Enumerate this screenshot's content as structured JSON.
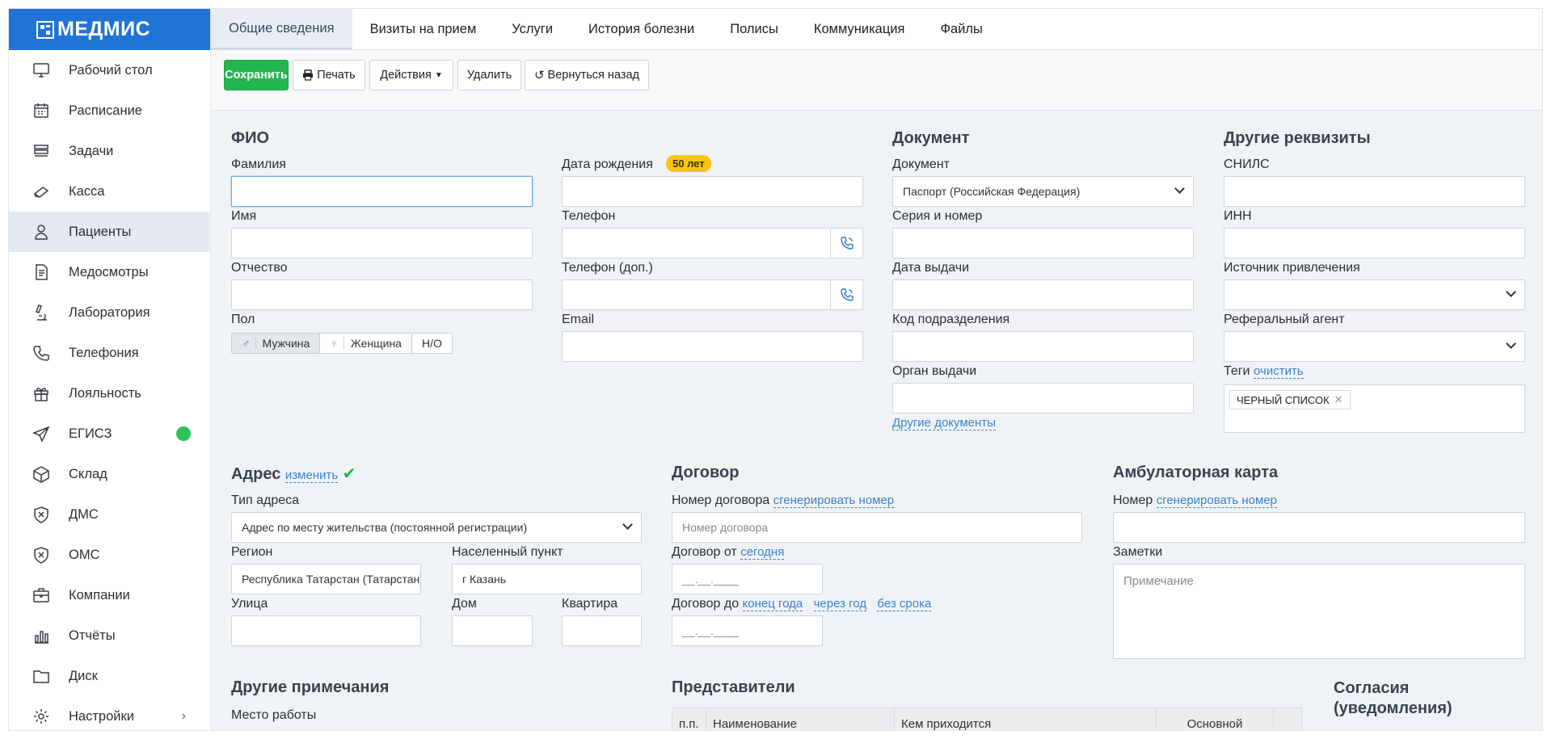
{
  "app": {
    "brand": "МЕДМИС"
  },
  "sidebar": {
    "items": [
      {
        "label": "Рабочий стол",
        "icon": "monitor-icon"
      },
      {
        "label": "Расписание",
        "icon": "calendar-icon"
      },
      {
        "label": "Задачи",
        "icon": "tasks-icon"
      },
      {
        "label": "Касса",
        "icon": "cash-icon"
      },
      {
        "label": "Пациенты",
        "icon": "patient-icon",
        "active": true
      },
      {
        "label": "Медосмотры",
        "icon": "document-icon"
      },
      {
        "label": "Лаборатория",
        "icon": "microscope-icon"
      },
      {
        "label": "Телефония",
        "icon": "phone-icon"
      },
      {
        "label": "Лояльность",
        "icon": "gift-icon"
      },
      {
        "label": "ЕГИСЗ",
        "icon": "send-icon",
        "status_color": "#2cc45a"
      },
      {
        "label": "Склад",
        "icon": "box-icon"
      },
      {
        "label": "ДМС",
        "icon": "shield-x-icon"
      },
      {
        "label": "ОМС",
        "icon": "shield-x-icon"
      },
      {
        "label": "Компании",
        "icon": "briefcase-icon"
      },
      {
        "label": "Отчёты",
        "icon": "bar-chart-icon"
      },
      {
        "label": "Диск",
        "icon": "folder-icon"
      },
      {
        "label": "Настройки",
        "icon": "gear-icon"
      }
    ]
  },
  "tabs": [
    "Общие сведения",
    "Визиты на прием",
    "Услуги",
    "История болезни",
    "Полисы",
    "Коммуникация",
    "Файлы"
  ],
  "toolbar": {
    "save": "Сохранить",
    "print": "Печать",
    "actions": "Действия",
    "delete": "Удалить",
    "back": "Вернуться назад"
  },
  "fio": {
    "title": "ФИО",
    "lastname_label": "Фамилия",
    "firstname_label": "Имя",
    "middlename_label": "Отчество",
    "gender_label": "Пол",
    "gender_options": [
      "Мужчина",
      "Женщина",
      "Н/О"
    ],
    "gender_selected": "Мужчина",
    "birth_label": "Дата рождения",
    "age_badge": "50 лет",
    "phone_label": "Телефон",
    "phone2_label": "Телефон (доп.)",
    "email_label": "Email"
  },
  "document": {
    "title": "Документ",
    "doc_label": "Документ",
    "doc_value": "Паспорт (Российская Федерация)",
    "series_label": "Серия и номер",
    "issue_date_label": "Дата выдачи",
    "dept_code_label": "Код подразделения",
    "issuer_label": "Орган выдачи",
    "other_docs_link": "Другие документы"
  },
  "other": {
    "title": "Другие реквизиты",
    "snils_label": "СНИЛС",
    "inn_label": "ИНН",
    "source_label": "Источник привлечения",
    "referral_label": "Реферальный агент",
    "tags_label": "Теги",
    "tags_clear": "очистить",
    "tags": [
      "ЧЕРНЫЙ СПИСОК"
    ]
  },
  "address": {
    "title": "Адрес",
    "change_link": "изменить",
    "type_label": "Тип адреса",
    "type_value": "Адрес по месту жительства (постоянной регистрации)",
    "region_label": "Регион",
    "region_value": "Республика Татарстан (Татарстан)",
    "city_label": "Населенный пункт",
    "city_value": "г Казань",
    "street_label": "Улица",
    "house_label": "Дом",
    "flat_label": "Квартира"
  },
  "contract": {
    "title": "Договор",
    "number_label": "Номер договора",
    "number_gen_link": "сгенерировать номер",
    "number_placeholder": "Номер договора",
    "from_label": "Договор от",
    "from_today_link": "сегодня",
    "date_placeholder": "__.__.____",
    "to_label": "Договор до",
    "to_links": [
      "конец года",
      "через год",
      "без срока"
    ]
  },
  "card": {
    "title": "Амбулаторная карта",
    "number_label": "Номер",
    "number_gen_link": "сгенерировать номер",
    "notes_label": "Заметки",
    "notes_placeholder": "Примечание"
  },
  "notes": {
    "title": "Другие примечания",
    "workplace_label": "Место работы"
  },
  "reps": {
    "title": "Представители",
    "columns": [
      "п.п.",
      "Наименование",
      "Кем приходится",
      "Основной",
      ""
    ]
  },
  "consents": {
    "title_line1": "Согласия",
    "title_line2": "(уведомления)"
  }
}
